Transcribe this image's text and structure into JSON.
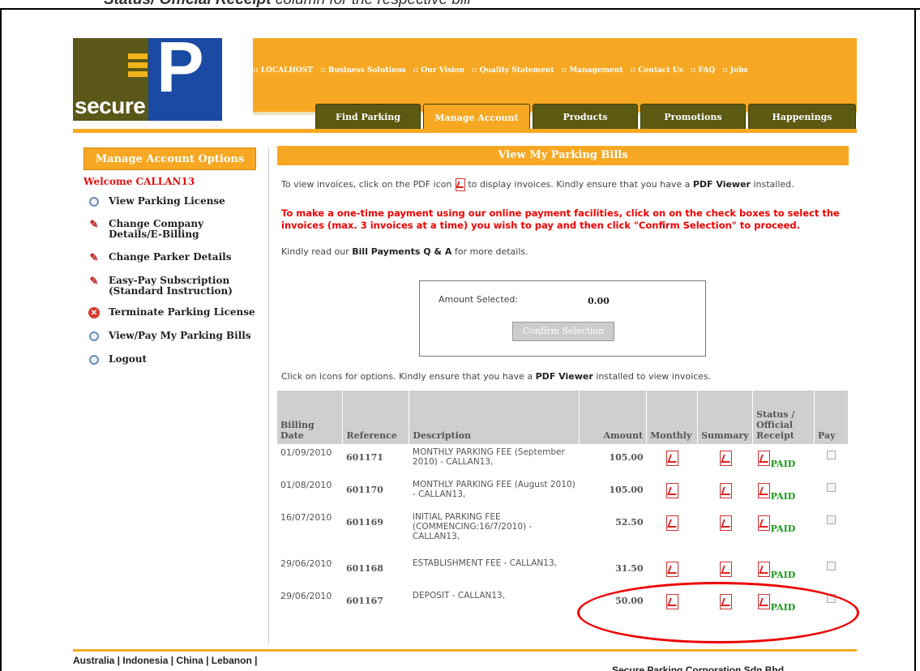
{
  "caption": {
    "bold": "Status/ Official Receipt",
    "rest": " column for the respective bill"
  },
  "logo": {
    "word": "secure",
    "letter": "P"
  },
  "top_links": [
    ":: LOCALHOST",
    ":: Business Solutions",
    ":: Our Vision",
    ":: Quality Statement",
    ":: Management",
    ":: Contact Us",
    ":: FAQ",
    ":: Jobs"
  ],
  "tabs": [
    {
      "label": "Find Parking",
      "active": false
    },
    {
      "label": "Manage Account",
      "active": true
    },
    {
      "label": "Products",
      "active": false
    },
    {
      "label": "Promotions",
      "active": false
    },
    {
      "label": "Happenings",
      "active": false
    }
  ],
  "sidebar": {
    "title": "Manage Account Options",
    "welcome": "Welcome CALLAN13",
    "items": [
      {
        "label": "View Parking License",
        "icon": "magnifier-icon"
      },
      {
        "label": "Change Company Details/E-Billing",
        "icon": "edit-icon"
      },
      {
        "label": "Change Parker Details",
        "icon": "edit-icon"
      },
      {
        "label": "Easy-Pay Subscription (Standard Instruction)",
        "icon": "edit-icon"
      },
      {
        "label": "Terminate Parking License",
        "icon": "cancel-icon"
      },
      {
        "label": "View/Pay My Parking Bills",
        "icon": "magnifier-icon"
      },
      {
        "label": "Logout",
        "icon": "magnifier-icon"
      }
    ]
  },
  "main": {
    "title": "View My Parking Bills",
    "p1_a": "To view invoices, click on the PDF icon",
    "p1_b": "to display invoices. Kindly ensure that you have a",
    "p1_c": "PDF Viewer",
    "p1_d": "installed.",
    "p2_line1": "To make a one-time payment using our online payment facilities, click on on the check boxes to select the",
    "p2_line2": "invoices (max. 3 invoices at a time) you wish to pay and then click \"Confirm Selection\" to proceed.",
    "p3_a": "Kindly read our",
    "p3_b": "Bill Payments Q & A",
    "p3_c": "for more details.",
    "amount_label": "Amount Selected:",
    "amount_value": "0.00",
    "confirm_label": "Confirm Selection",
    "p4_a": "Click on icons for options. Kindly ensure that you have a",
    "p4_b": "PDF Viewer",
    "p4_c": "installed to view invoices."
  },
  "table": {
    "headers": [
      "Billing Date",
      "Reference",
      "Description",
      "Amount",
      "Monthly",
      "Summary",
      "Status / Official Receipt",
      "Pay"
    ],
    "rows": [
      {
        "date": "01/09/2010",
        "ref": "601171",
        "desc": "MONTHLY PARKING FEE (September 2010) - CALLAN13,",
        "amount": "105.00",
        "status": "PAID"
      },
      {
        "date": "01/08/2010",
        "ref": "601170",
        "desc": "MONTHLY PARKING FEE (August 2010) - CALLAN13,",
        "amount": "105.00",
        "status": "PAID"
      },
      {
        "date": "16/07/2010",
        "ref": "601169",
        "desc": "INITIAL PARKING FEE (COMMENCING:16/7/2010) - CALLAN13,",
        "amount": "52.50",
        "status": "PAID"
      },
      {
        "date": "29/06/2010",
        "ref": "601168",
        "desc": "ESTABLISHMENT FEE - CALLAN13,",
        "amount": "31.50",
        "status": "PAID"
      },
      {
        "date": "29/06/2010",
        "ref": "601167",
        "desc": "DEPOSIT - CALLAN13,",
        "amount": "50.00",
        "status": "PAID"
      }
    ]
  },
  "footer": {
    "countries": "Australia | Indonesia | China | Lebanon |",
    "company": "Secure Parking Corporation Sdn Bhd"
  },
  "colors": {
    "orange": "#f7a823",
    "olive": "#5c5a12",
    "red": "#e00000",
    "green": "#1a9a1a",
    "blue": "#1a4aa3"
  }
}
